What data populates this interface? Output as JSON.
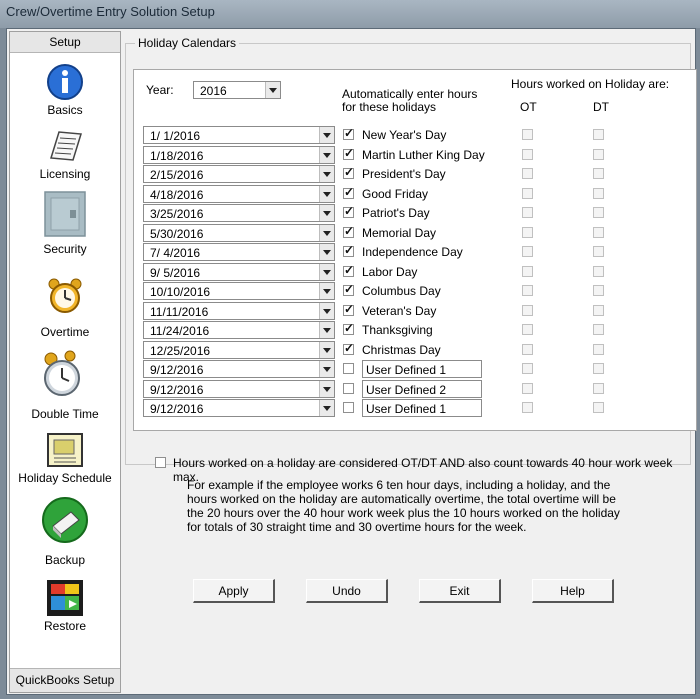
{
  "window": {
    "title": "Crew/Overtime Entry Solution Setup"
  },
  "sidebar": {
    "header": "Setup",
    "footer": "QuickBooks Setup",
    "items": [
      {
        "label": "Basics",
        "icon": "info-icon"
      },
      {
        "label": "Licensing",
        "icon": "document-icon"
      },
      {
        "label": "Security",
        "icon": "safe-icon"
      },
      {
        "label": "Overtime",
        "icon": "alarm-clock-icon"
      },
      {
        "label": "Double Time",
        "icon": "stopwatch-icon"
      },
      {
        "label": "Holiday Schedule",
        "icon": "calendar-icon"
      },
      {
        "label": "Backup",
        "icon": "backup-disk-icon"
      },
      {
        "label": "Restore",
        "icon": "restore-icon"
      }
    ]
  },
  "holiday": {
    "group_title": "Holiday Calendars",
    "year_label": "Year:",
    "year_value": "2016",
    "auto_enter_label": "Automatically enter  hours\nfor these holidays",
    "hours_worked_label": "Hours worked on Holiday are:",
    "ot_label": "OT",
    "dt_label": "DT",
    "rows": [
      {
        "date": "1/  1/2016",
        "checked": true,
        "name": "New Year's Day"
      },
      {
        "date": "1/18/2016",
        "checked": true,
        "name": "Martin Luther King Day"
      },
      {
        "date": "2/15/2016",
        "checked": true,
        "name": "President's Day"
      },
      {
        "date": "4/18/2016",
        "checked": true,
        "name": "Good Friday"
      },
      {
        "date": "3/25/2016",
        "checked": true,
        "name": "Patriot's Day"
      },
      {
        "date": "5/30/2016",
        "checked": true,
        "name": "Memorial Day"
      },
      {
        "date": "7/  4/2016",
        "checked": true,
        "name": "Independence Day"
      },
      {
        "date": "9/  5/2016",
        "checked": true,
        "name": "Labor Day"
      },
      {
        "date": "10/10/2016",
        "checked": true,
        "name": "Columbus Day"
      },
      {
        "date": "11/11/2016",
        "checked": true,
        "name": "Veteran's Day"
      },
      {
        "date": "11/24/2016",
        "checked": true,
        "name": "Thanksgiving"
      },
      {
        "date": "12/25/2016",
        "checked": true,
        "name": "Christmas Day"
      },
      {
        "date": "9/12/2016",
        "checked": false,
        "name": "User Defined 1",
        "editable": true
      },
      {
        "date": "9/12/2016",
        "checked": false,
        "name": "User Defined 2",
        "editable": true
      },
      {
        "date": "9/12/2016",
        "checked": false,
        "name": "User Defined 1",
        "editable": true
      }
    ]
  },
  "ot_dt_option": {
    "label": "Hours worked on a holiday are considered OT/DT AND also count towards 40 hour work week max.",
    "checked": false,
    "note": "For example if the employee works 6 ten hour days, including a holiday, and the hours worked on the holiday are automatically overtime, the total overtime will be the 20 hours over the 40 hour work week plus the 10 hours worked on the holiday for totals of 30 straight time and 30 overtime hours for the week."
  },
  "buttons": {
    "apply": "Apply",
    "undo": "Undo",
    "exit": "Exit",
    "help": "Help"
  }
}
